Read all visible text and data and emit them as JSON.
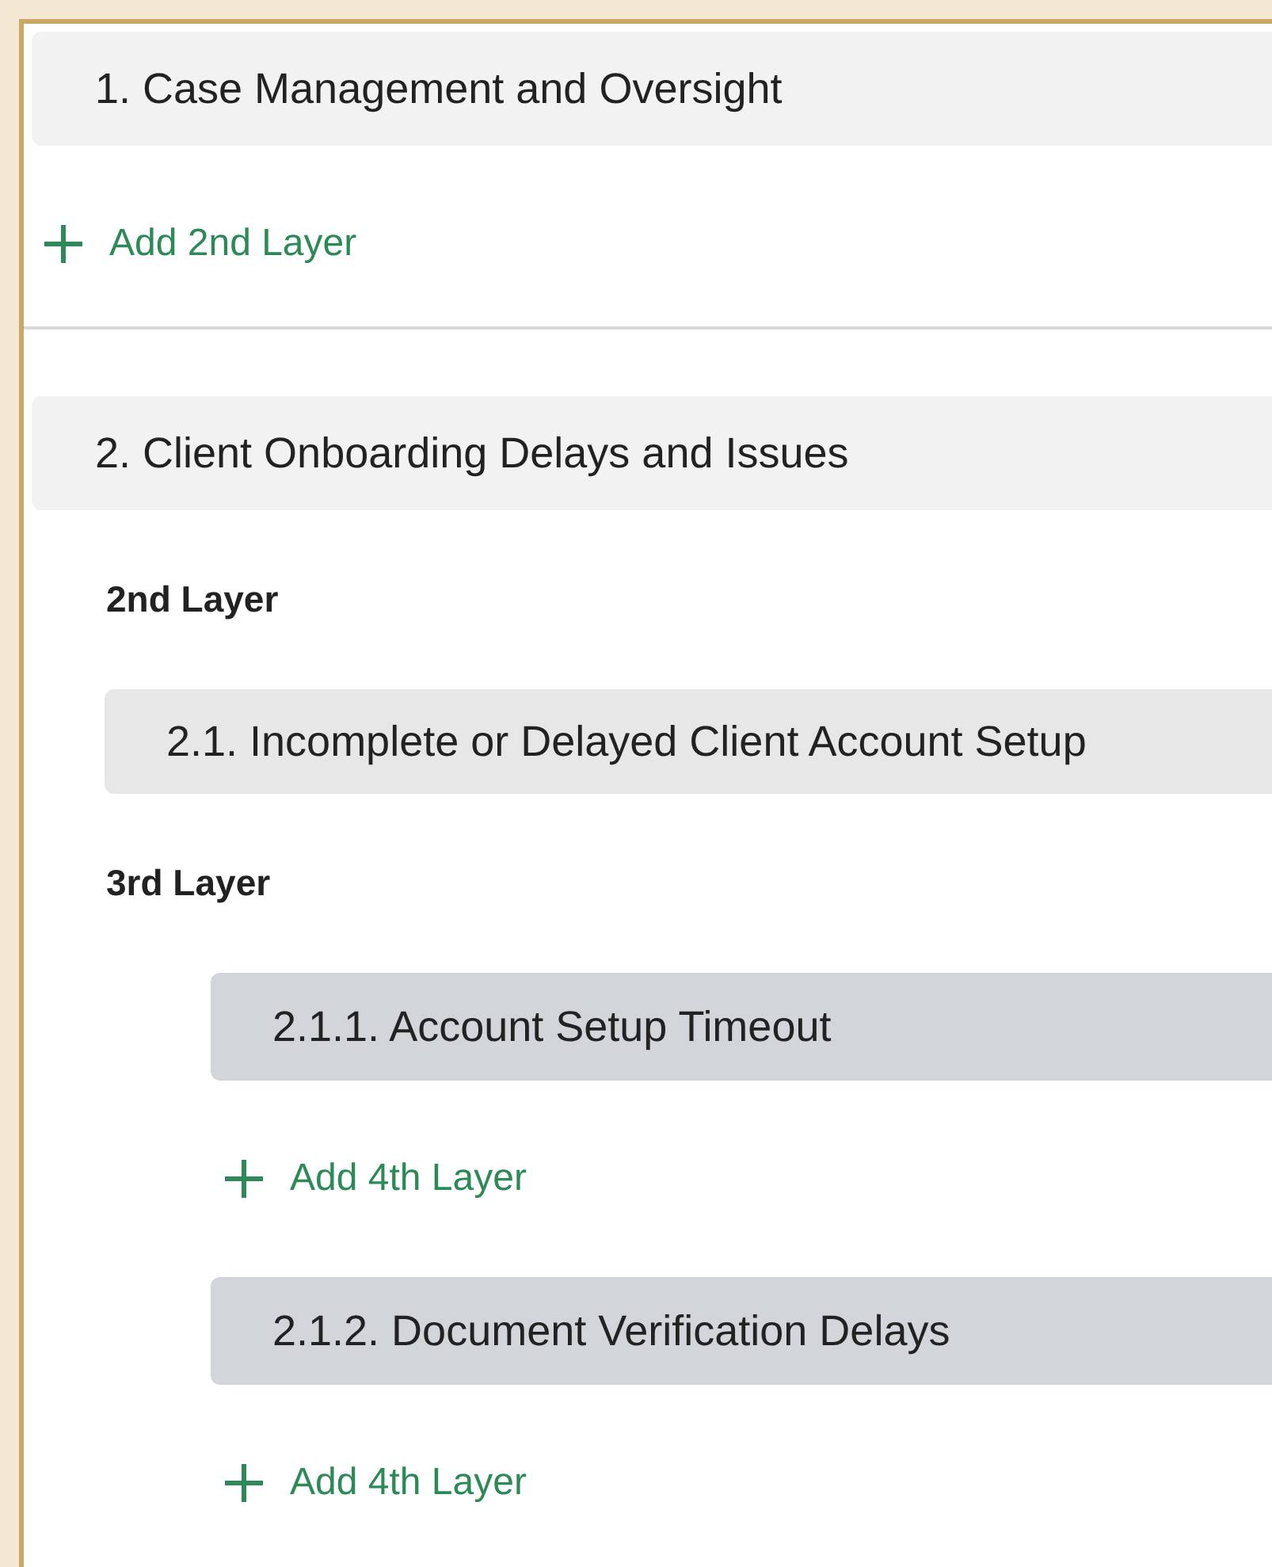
{
  "categories": [
    {
      "label": "1. Case Management and Oversight",
      "add_button": "Add 2nd Layer"
    },
    {
      "label": "2. Client Onboarding Delays and Issues",
      "children_heading": "2nd Layer",
      "children": [
        {
          "label": "2.1. Incomplete or Delayed Client Account Setup",
          "children_heading": "3rd Layer",
          "children": [
            {
              "label": "2.1.1. Account Setup Timeout",
              "add_button": "Add 4th Layer"
            },
            {
              "label": "2.1.2. Document Verification Delays",
              "add_button": "Add 4th Layer"
            }
          ]
        }
      ]
    }
  ]
}
